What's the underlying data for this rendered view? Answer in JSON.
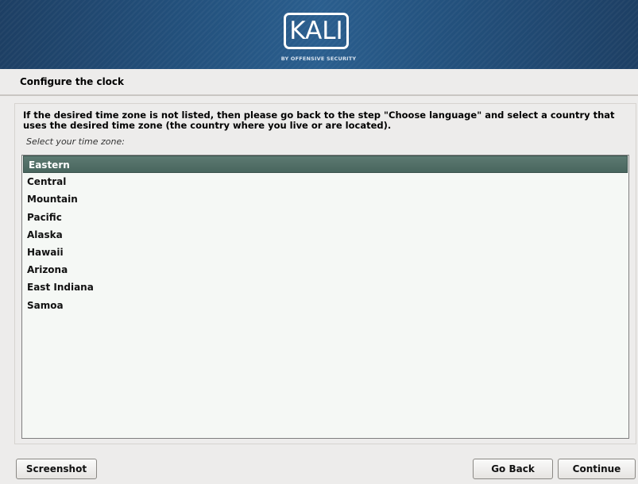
{
  "banner": {
    "logo_text": "KALI",
    "logo_subtext": "BY OFFENSIVE SECURITY"
  },
  "page": {
    "title": "Configure the clock"
  },
  "content": {
    "instruction": "If the desired time zone is not listed, then please go back to the step \"Choose language\" and select a country that uses the desired time zone (the country where you live or are located).",
    "prompt": "Select your time zone:"
  },
  "timezones": {
    "selected": "Eastern",
    "items": [
      "Eastern",
      "Central",
      "Mountain",
      "Pacific",
      "Alaska",
      "Hawaii",
      "Arizona",
      "East Indiana",
      "Samoa"
    ]
  },
  "buttons": {
    "screenshot": "Screenshot",
    "go_back": "Go Back",
    "continue": "Continue"
  },
  "colors": {
    "banner": "#23517d",
    "selection": "#48665e",
    "background": "#edeceb"
  }
}
